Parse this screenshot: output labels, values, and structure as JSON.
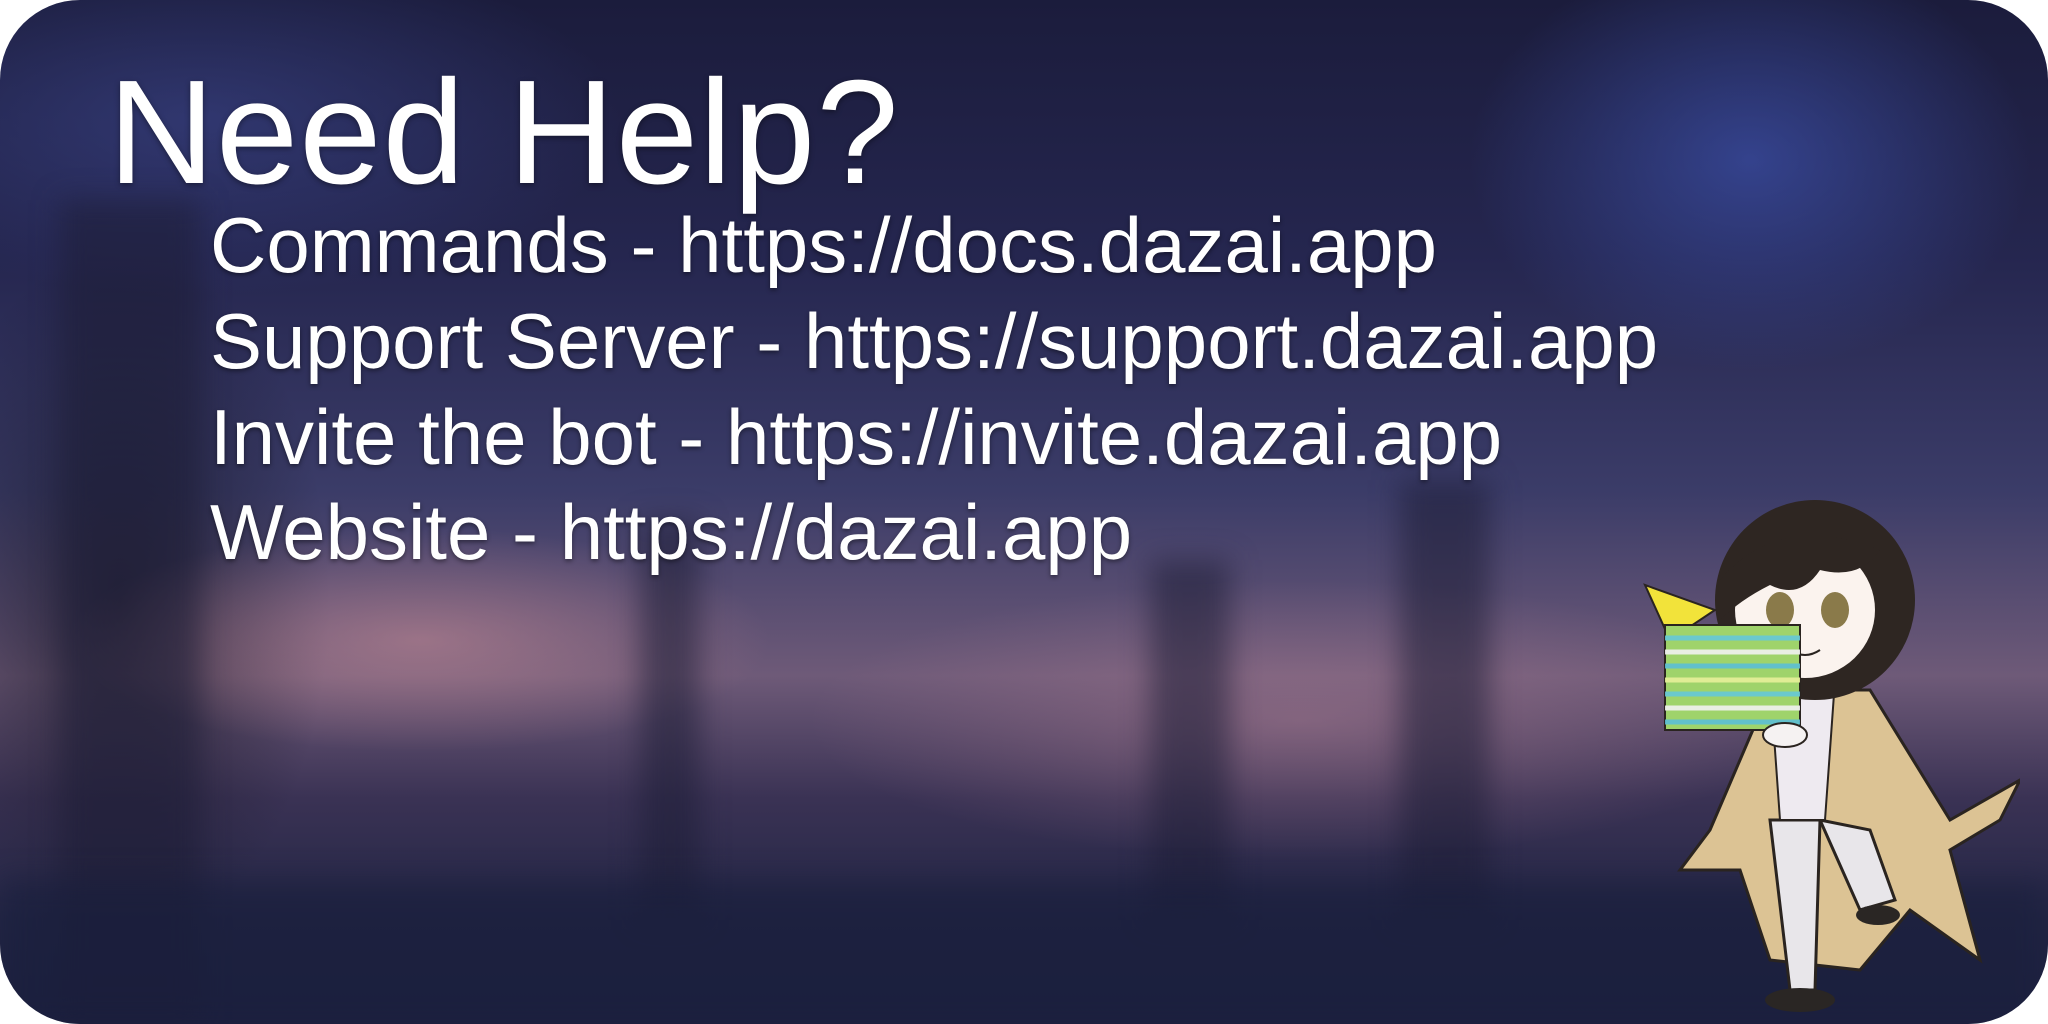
{
  "title": "Need Help?",
  "links": [
    {
      "label": "Commands",
      "separator": " - ",
      "url": "https://docs.dazai.app"
    },
    {
      "label": "Support Server",
      "separator": " - ",
      "url": "https://support.dazai.app"
    },
    {
      "label": "Invite the bot",
      "separator": " - ",
      "url": "https://invite.dazai.app"
    },
    {
      "label": "Website",
      "separator": " - ",
      "url": "https://dazai.app"
    }
  ]
}
